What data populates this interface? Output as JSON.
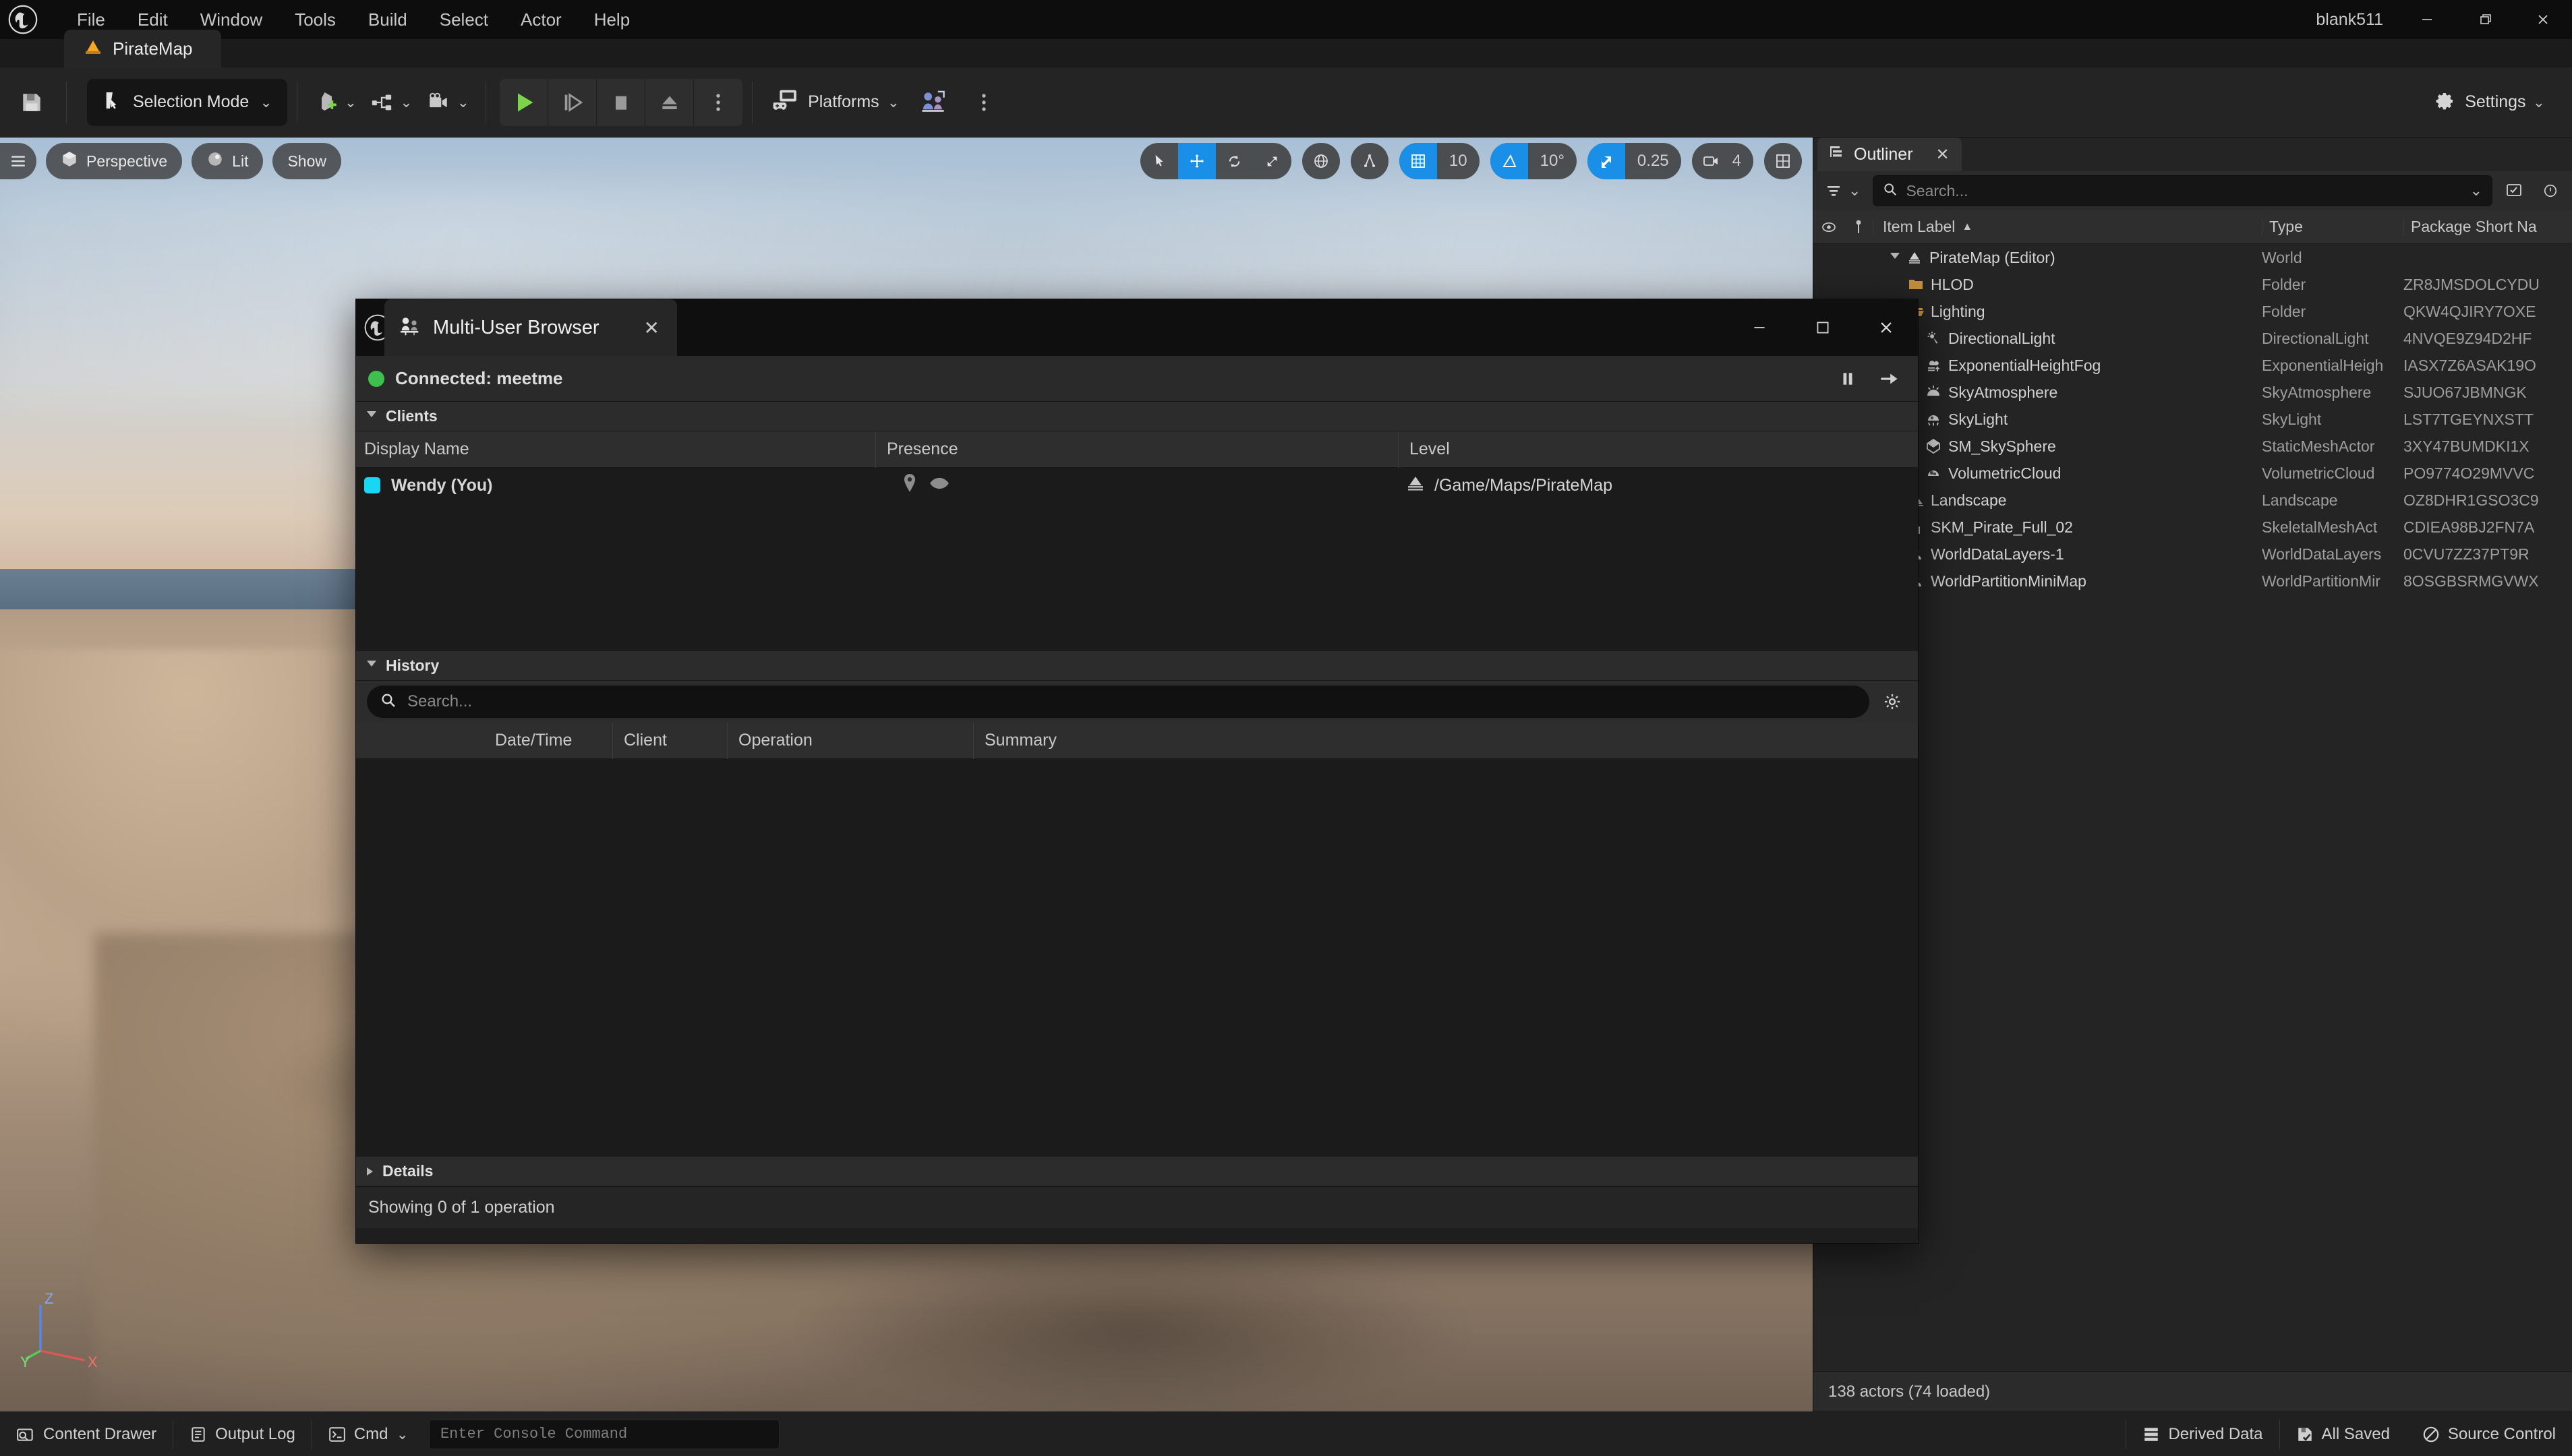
{
  "window": {
    "title": "blank511",
    "controls": {
      "minimize": "minimize-icon",
      "maximize": "maximize-icon",
      "close": "close-icon"
    }
  },
  "menubar": {
    "logo": "unreal-engine-logo",
    "items": [
      {
        "label": "File"
      },
      {
        "label": "Edit"
      },
      {
        "label": "Window"
      },
      {
        "label": "Tools"
      },
      {
        "label": "Build"
      },
      {
        "label": "Select"
      },
      {
        "label": "Actor"
      },
      {
        "label": "Help"
      }
    ]
  },
  "level_tab": {
    "label": "PirateMap",
    "icon": "level-icon"
  },
  "toolbar": {
    "save_icon": "save-icon",
    "mode": {
      "label": "Selection Mode",
      "icon": "selection-mode-icon",
      "chevron": "chevron-down-icon"
    },
    "add_actor": {
      "icon": "add-actor-icon",
      "chevron": "chevron-down-icon"
    },
    "blueprints": {
      "icon": "blueprints-icon",
      "chevron": "chevron-down-icon"
    },
    "cinematics": {
      "icon": "cinematics-icon",
      "chevron": "chevron-down-icon"
    },
    "play": {
      "icon": "play-icon"
    },
    "skip": {
      "icon": "skip-icon"
    },
    "stop": {
      "icon": "stop-icon"
    },
    "eject": {
      "icon": "eject-icon"
    },
    "play_options": {
      "icon": "kebab-icon"
    },
    "platforms": {
      "label": "Platforms",
      "icon": "platforms-icon",
      "chevron": "chevron-down-icon"
    },
    "multi_user": {
      "icon": "multi-user-icon"
    },
    "multi_user_options": {
      "icon": "kebab-icon"
    },
    "settings": {
      "label": "Settings",
      "icon": "gear-icon",
      "chevron": "chevron-down-icon"
    }
  },
  "viewport": {
    "menu_icon": "hamburger-icon",
    "view_mode": {
      "label": "Perspective",
      "icon": "cube-icon"
    },
    "lighting": {
      "label": "Lit",
      "icon": "sphere-icon"
    },
    "show": {
      "label": "Show"
    },
    "transform_tools": [
      {
        "name": "select-tool",
        "icon": "cursor-icon",
        "active": false
      },
      {
        "name": "translate-tool",
        "icon": "move-icon",
        "active": true
      },
      {
        "name": "rotate-tool",
        "icon": "rotate-icon",
        "active": false
      },
      {
        "name": "scale-tool",
        "icon": "scale-icon",
        "active": false
      }
    ],
    "coordinate_system": {
      "icon": "globe-icon"
    },
    "surface_snap": {
      "icon": "surface-snap-icon"
    },
    "grid_snap": {
      "icon": "grid-icon",
      "value": "10",
      "active": true
    },
    "angle_snap": {
      "icon": "angle-icon",
      "value": "10°",
      "active": true
    },
    "scale_snap": {
      "icon": "scale-snap-icon",
      "value": "0.25",
      "active": true
    },
    "camera_speed": {
      "icon": "camera-icon",
      "value": "4"
    },
    "viewport_layout": {
      "icon": "layout-grid-icon"
    },
    "axis_gizmo": {
      "x": "X",
      "y": "Y",
      "z": "Z"
    }
  },
  "outliner": {
    "tab": {
      "label": "Outliner",
      "icon": "outliner-icon",
      "close": "close-icon"
    },
    "filter_icon": "filter-icon",
    "filter_chevron": "chevron-down-icon",
    "search": {
      "placeholder": "Search...",
      "icon": "search-icon"
    },
    "settings_icon": "settings-icon",
    "options_icon": "options-icon",
    "columns": [
      {
        "label": "",
        "name": "visibility"
      },
      {
        "label": "",
        "name": "pin"
      },
      {
        "label": "Item Label",
        "sort": "▲"
      },
      {
        "label": "Type"
      },
      {
        "label": "Package Short Na"
      }
    ],
    "rows": [
      {
        "label": "PirateMap (Editor)",
        "type": "World",
        "package": "",
        "icon": "world-icon",
        "indent": 1,
        "expander": "down"
      },
      {
        "label": "HLOD",
        "type": "Folder",
        "package": "ZR8JMSDOLCYDU",
        "icon": "folder-closed-icon",
        "indent": 2
      },
      {
        "label": "Lighting",
        "type": "Folder",
        "package": "QKW4QJIRY7OXE",
        "icon": "folder-open-icon",
        "indent": 2
      },
      {
        "label": "DirectionalLight",
        "type": "DirectionalLight",
        "package": "4NVQE9Z94D2HF",
        "icon": "directional-light-icon",
        "indent": 3
      },
      {
        "label": "ExponentialHeightFog",
        "type": "ExponentialHeigh",
        "package": "IASX7Z6ASAK19O",
        "icon": "fog-icon",
        "indent": 3
      },
      {
        "label": "SkyAtmosphere",
        "type": "SkyAtmosphere",
        "package": "SJUO67JBMNGK",
        "icon": "sky-atmosphere-icon",
        "indent": 3
      },
      {
        "label": "SkyLight",
        "type": "SkyLight",
        "package": "LST7TGEYNXSTT",
        "icon": "sky-light-icon",
        "indent": 3
      },
      {
        "label": "SM_SkySphere",
        "type": "StaticMeshActor",
        "package": "3XY47BUMDKI1X",
        "icon": "static-mesh-icon",
        "indent": 3
      },
      {
        "label": "VolumetricCloud",
        "type": "VolumetricCloud",
        "package": "PO9774O29MVVC",
        "icon": "volumetric-cloud-icon",
        "indent": 3
      },
      {
        "label": "Landscape",
        "type": "Landscape",
        "package": "OZ8DHR1GSO3C9",
        "icon": "landscape-icon",
        "indent": 2
      },
      {
        "label": "SKM_Pirate_Full_02",
        "type": "SkeletalMeshAct",
        "package": "CDIEA98BJ2FN7A",
        "icon": "skeletal-mesh-icon",
        "indent": 2
      },
      {
        "label": "WorldDataLayers-1",
        "type": "WorldDataLayers",
        "package": "0CVU7ZZ37PT9R",
        "icon": "actor-icon",
        "indent": 2
      },
      {
        "label": "WorldPartitionMiniMap",
        "type": "WorldPartitionMir",
        "package": "8OSGBSRMGVWX",
        "icon": "actor-icon",
        "indent": 2
      }
    ],
    "footer": "138 actors (74 loaded)"
  },
  "multi_user_browser": {
    "tab": {
      "label": "Multi-User Browser",
      "icon": "multi-user-icon",
      "close": "close-icon"
    },
    "logo": "unreal-engine-logo",
    "window_controls": {
      "minimize": "minimize-icon",
      "maximize": "maximize-icon",
      "close": "close-icon"
    },
    "status": {
      "text": "Connected: meetme",
      "indicator_color": "#3fbf4e"
    },
    "status_actions": [
      {
        "name": "pause-session-button",
        "icon": "pause-icon"
      },
      {
        "name": "leave-session-button",
        "icon": "leave-icon"
      }
    ],
    "clients_section": {
      "label": "Clients",
      "expander": "down",
      "columns": [
        "Display Name",
        "Presence",
        "Level"
      ],
      "rows": [
        {
          "display_name": "Wendy (You)",
          "swatch_color": "#18d7f5",
          "presence_icons": [
            "location-pin-icon",
            "eye-icon"
          ],
          "level": "/Game/Maps/PirateMap",
          "level_icon": "level-icon"
        }
      ]
    },
    "history_section": {
      "label": "History",
      "expander": "down",
      "search": {
        "placeholder": "Search...",
        "icon": "search-icon"
      },
      "settings_icon": "gear-icon",
      "columns": [
        "Date/Time",
        "Client",
        "Operation",
        "Summary"
      ],
      "rows": []
    },
    "details_section": {
      "label": "Details",
      "expander": "right"
    },
    "footer": "Showing 0 of 1 operation"
  },
  "statusbar": {
    "left_items": [
      {
        "label": "Content Drawer",
        "icon": "content-drawer-icon"
      },
      {
        "label": "Output Log",
        "icon": "output-log-icon"
      },
      {
        "label": "Cmd",
        "icon": "cmd-icon",
        "chevron": "chevron-down-icon"
      }
    ],
    "console": {
      "placeholder": "Enter Console Command"
    },
    "right_items": [
      {
        "label": "Derived Data",
        "icon": "derived-data-icon"
      },
      {
        "label": "All Saved",
        "icon": "all-saved-icon"
      },
      {
        "label": "Source Control",
        "icon": "source-control-icon"
      }
    ]
  }
}
